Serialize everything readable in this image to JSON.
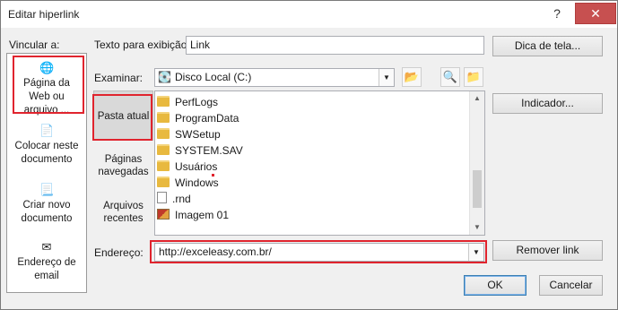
{
  "window": {
    "title": "Editar hiperlink",
    "help": "?",
    "close": "✕"
  },
  "link_to": {
    "heading": "Vincular a:",
    "items": [
      {
        "label_lines": [
          "Página da",
          "Web ou",
          "arquivo ..."
        ],
        "icon": "globe-page-icon"
      },
      {
        "label_lines": [
          "Colocar neste",
          "documento"
        ],
        "icon": "document-place-icon"
      },
      {
        "label_lines": [
          "Criar novo",
          "documento"
        ],
        "icon": "new-document-icon"
      },
      {
        "label_lines": [
          "Endereço de",
          "email"
        ],
        "icon": "email-icon"
      }
    ]
  },
  "display_text": {
    "label": "Texto para exibição:",
    "value": "Link"
  },
  "screen_tip_button": "Dica de tela...",
  "look_in": {
    "label": "Examinar:",
    "value": "Disco Local (C:)",
    "icon": "drive-icon"
  },
  "toolbar_icons": [
    "folder-up-icon",
    "browse-web-icon",
    "browse-file-icon"
  ],
  "nav": {
    "items": [
      {
        "label_lines": [
          "Pasta atual"
        ],
        "selected": true
      },
      {
        "label_lines": [
          "Páginas",
          "navegadas"
        ],
        "selected": false
      },
      {
        "label_lines": [
          "Arquivos",
          "recentes"
        ],
        "selected": false
      }
    ]
  },
  "files": [
    {
      "name": "PerfLogs",
      "kind": "folder"
    },
    {
      "name": "ProgramData",
      "kind": "folder"
    },
    {
      "name": "SWSetup",
      "kind": "folder"
    },
    {
      "name": "SYSTEM.SAV",
      "kind": "folder"
    },
    {
      "name": "Usuários",
      "kind": "folder"
    },
    {
      "name": "Windows",
      "kind": "folder"
    },
    {
      "name": ".rnd",
      "kind": "file"
    },
    {
      "name": "Imagem 01",
      "kind": "image"
    }
  ],
  "bookmark_button": "Indicador...",
  "address": {
    "label": "Endereço:",
    "value": "http://exceleasy.com.br/"
  },
  "remove_link_button": "Remover link",
  "ok_button": "OK",
  "cancel_button": "Cancelar",
  "colors": {
    "highlight": "#e0242e",
    "close": "#c75050"
  }
}
